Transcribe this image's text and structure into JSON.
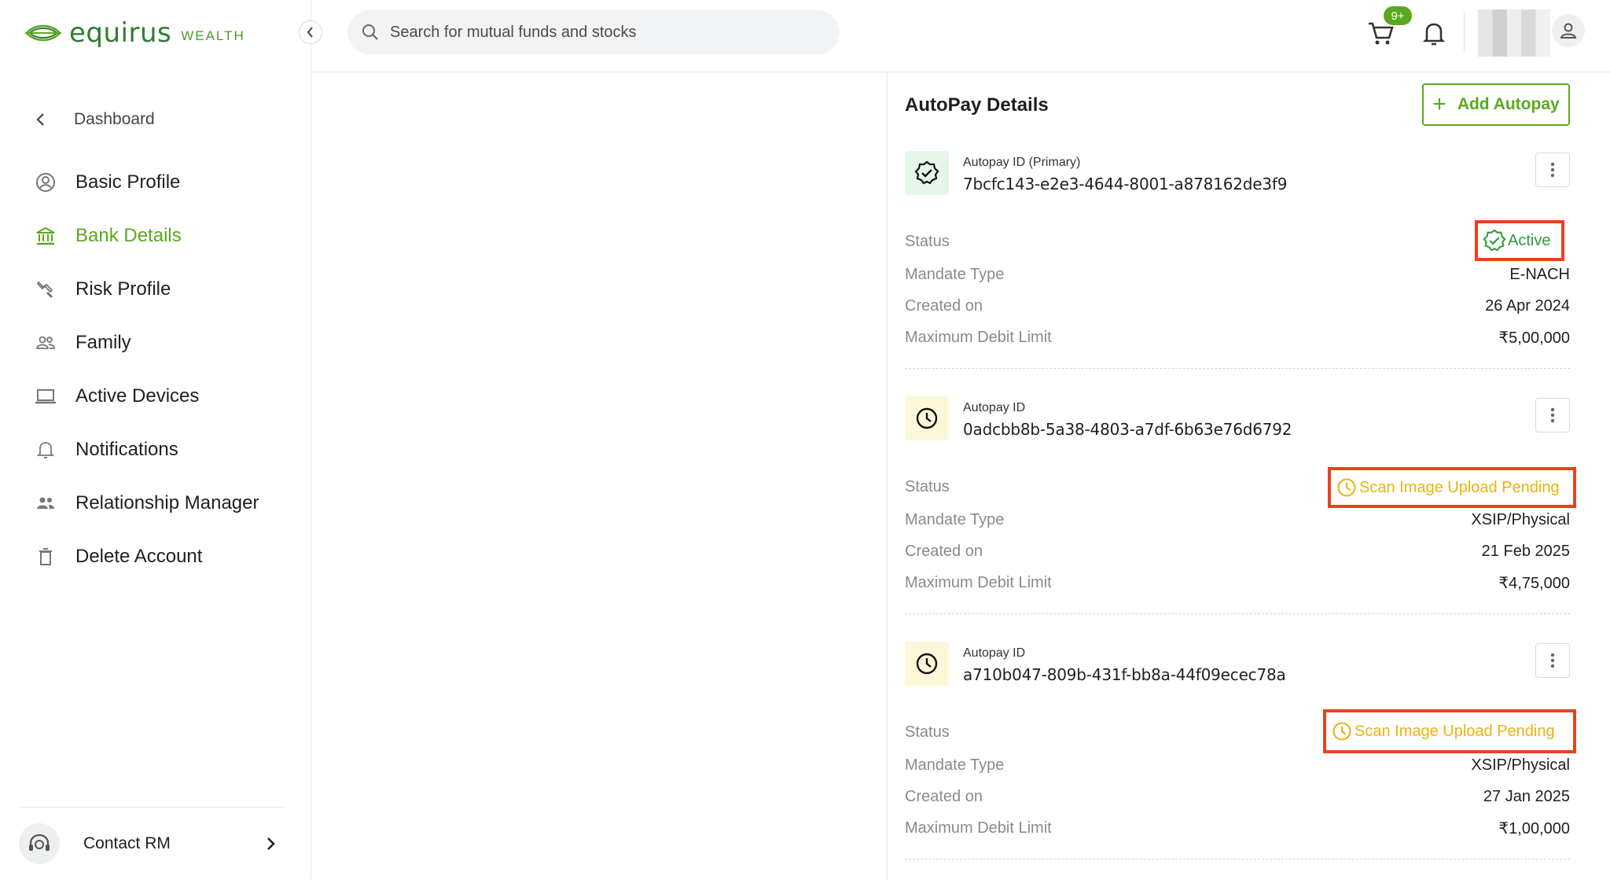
{
  "brand": {
    "name": "equirus",
    "sub": "WEALTH"
  },
  "sidebar": {
    "back_label": "Dashboard",
    "items": [
      {
        "label": "Basic Profile",
        "icon": "user-circle-icon",
        "active": false
      },
      {
        "label": "Bank Details",
        "icon": "bank-icon",
        "active": true
      },
      {
        "label": "Risk Profile",
        "icon": "wrench-icon",
        "active": false
      },
      {
        "label": "Family",
        "icon": "family-icon",
        "active": false
      },
      {
        "label": "Active Devices",
        "icon": "laptop-icon",
        "active": false
      },
      {
        "label": "Notifications",
        "icon": "bell-icon",
        "active": false
      },
      {
        "label": "Relationship Manager",
        "icon": "people-icon",
        "active": false
      },
      {
        "label": "Delete Account",
        "icon": "trash-icon",
        "active": false
      }
    ],
    "contact_label": "Contact RM"
  },
  "header": {
    "search_placeholder": "Search for mutual funds and stocks",
    "cart_badge": "9+"
  },
  "autopay": {
    "title": "AutoPay Details",
    "add_label": "Add Autopay",
    "keys": {
      "status": "Status",
      "mandate": "Mandate Type",
      "created": "Created on",
      "limit": "Maximum Debit Limit"
    },
    "cards": [
      {
        "id_label": "Autopay ID (Primary)",
        "id": "7bcfc143-e2e3-4644-8001-a878162de3f9",
        "status": "Active",
        "mandate": "E-NACH",
        "created": "26 Apr 2024",
        "limit": "₹5,00,000"
      },
      {
        "id_label": "Autopay ID",
        "id": "0adcbb8b-5a38-4803-a7df-6b63e76d6792",
        "status": "Scan Image Upload Pending",
        "mandate": "XSIP/Physical",
        "created": "21 Feb 2025",
        "limit": "₹4,75,000"
      },
      {
        "id_label": "Autopay ID",
        "id": "a710b047-809b-431f-bb8a-44f09ecec78a",
        "status": "Scan Image Upload Pending",
        "mandate": "XSIP/Physical",
        "created": "27 Jan 2025",
        "limit": "₹1,00,000"
      }
    ]
  },
  "colors": {
    "brand_green": "#5aa81f",
    "active_green": "#2e9a3e",
    "pending_yellow": "#e8b40c",
    "highlight_red": "#e8421f"
  }
}
